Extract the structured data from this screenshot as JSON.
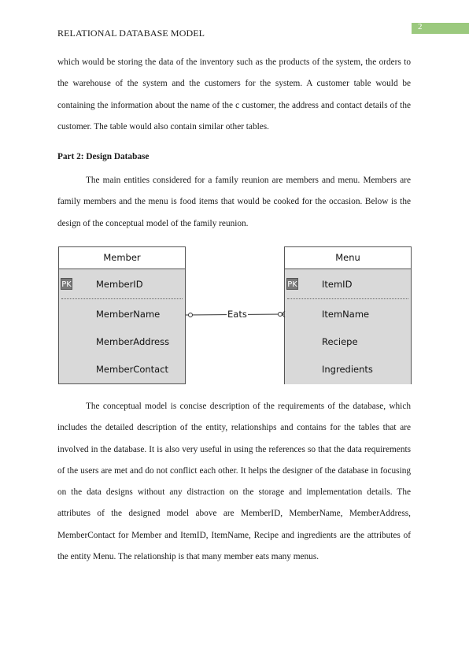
{
  "header": {
    "title": "RELATIONAL DATABASE MODEL",
    "page_number": "2",
    "page_badge_color": "#9bc97e"
  },
  "paragraphs": {
    "intro": "which would be storing the data of the inventory such as the products of the system, the orders to the warehouse of the system and the customers for the system. A customer table would be containing the information about the name of the c customer, the address and contact details of the customer. The table would also contain similar other tables.",
    "section_heading": "Part 2: Design Database",
    "entities_intro": "The main entities considered for a family reunion are members and menu. Members are family members and the menu is food items that would be cooked for the occasion. Below is the design of the conceptual model of the family reunion.",
    "conceptual": "The conceptual model is concise description of the requirements of the database, which includes the detailed description of the entity, relationships and contains for the tables that are involved in the database. It is also very useful in using the references so that the data requirements of the users are met and do not conflict each other. It helps the designer of the database in focusing on the data designs without any distraction on the storage and implementation details. The attributes of the designed model above are MemberID, MemberName, MemberAddress, MemberContact for Member and ItemID, ItemName, Recipe and ingredients are the attributes of the entity Menu. The relationship is that many member eats many menus."
  },
  "diagram": {
    "entities": [
      {
        "name": "Member",
        "pk_badge": "PK",
        "primary_key": "MemberID",
        "attributes": [
          "MemberName",
          "MemberAddress",
          "MemberContact"
        ]
      },
      {
        "name": "Menu",
        "pk_badge": "PK",
        "primary_key": "ItemID",
        "attributes": [
          "ItemName",
          "Reciepe",
          "Ingredients"
        ]
      }
    ],
    "relationship": {
      "label": "Eats",
      "from": "Member",
      "to": "Menu",
      "from_end": "zero",
      "to_end": "zero-or-many"
    }
  }
}
